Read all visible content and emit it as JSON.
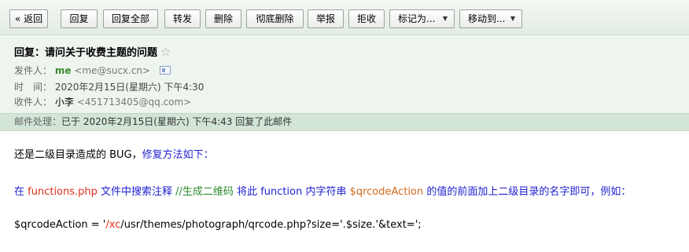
{
  "toolbar": {
    "back": "« 返回",
    "reply": "回复",
    "reply_all": "回复全部",
    "forward": "转发",
    "delete": "删除",
    "delete_perm": "彻底删除",
    "report": "举报",
    "reject": "拒收",
    "mark_as": "标记为...",
    "move_to": "移动到..."
  },
  "mail": {
    "subject": "回复：请问关于收费主题的问题",
    "star": "☆",
    "from_label": "发件人：",
    "from_name": "me",
    "from_email": "<me@sucx.cn>",
    "time_label": "时　间：",
    "time": "2020年2月15日(星期六) 下午4:30",
    "to_label": "收件人：",
    "to_name": "小李",
    "to_email": "<451713405@qq.com>",
    "status_label": "邮件处理：",
    "status_text": "已于 2020年2月15日(星期六) 下午4:43 回复了此邮件"
  },
  "content": {
    "line1_a": "还是二级目录造成的 BUG，",
    "line1_b": "修复方法如下：",
    "line2_a": "在 ",
    "line2_b": "functions.php",
    "line2_c": " 文件中搜索注释 ",
    "line2_d": "//生成二维码",
    "line2_e": " 将此 function 内字符串 ",
    "line2_f": "$qrcodeAction",
    "line2_g": " 的值的前面加上二级目录的名字即可，例如：",
    "line3_a": "$qrcodeAction = '",
    "line3_b": "/xc",
    "line3_c": "/usr/themes/photograph/qrcode.php?size='.$size.'&text=';"
  },
  "colors": {
    "toolbar_bg": "#e2ece4",
    "header_bg": "#eef5ef",
    "status_bg": "#d3e5d6",
    "sender_name": "#3b8a2e",
    "link_blue": "#1f1fd0",
    "accent_red": "#e0301e"
  },
  "icons": {
    "star": "star-icon",
    "contact_card": "contact-card-icon",
    "dropdown": "chevron-down-icon"
  }
}
